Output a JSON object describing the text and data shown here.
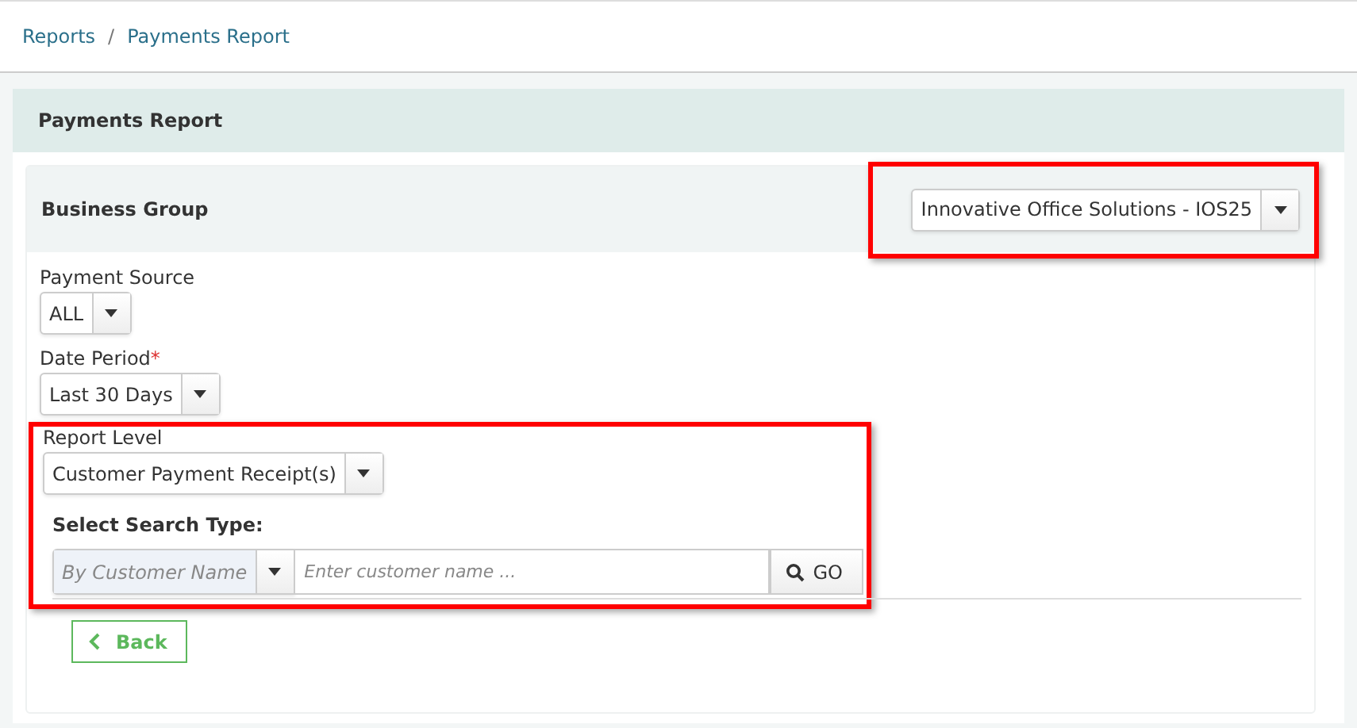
{
  "breadcrumb": {
    "items": [
      "Reports",
      "Payments Report"
    ],
    "separator": "/"
  },
  "panel_title": "Payments Report",
  "business_group": {
    "label": "Business Group",
    "value": "Innovative Office Solutions - IOS25",
    "highlighted": true
  },
  "fields": [
    {
      "label": "Payment Source",
      "value": "ALL"
    },
    {
      "label": "Date Period",
      "required_mark": "*",
      "value": "Last 30 Days"
    }
  ],
  "report_level": {
    "label": "Report Level",
    "value": "Customer Payment Receipt(s)",
    "highlighted": true,
    "search_label": "Select Search Type:",
    "search_type": "By Customer Name",
    "placeholder": "Enter customer name ...",
    "go": "GO"
  },
  "back_button": "Back"
}
